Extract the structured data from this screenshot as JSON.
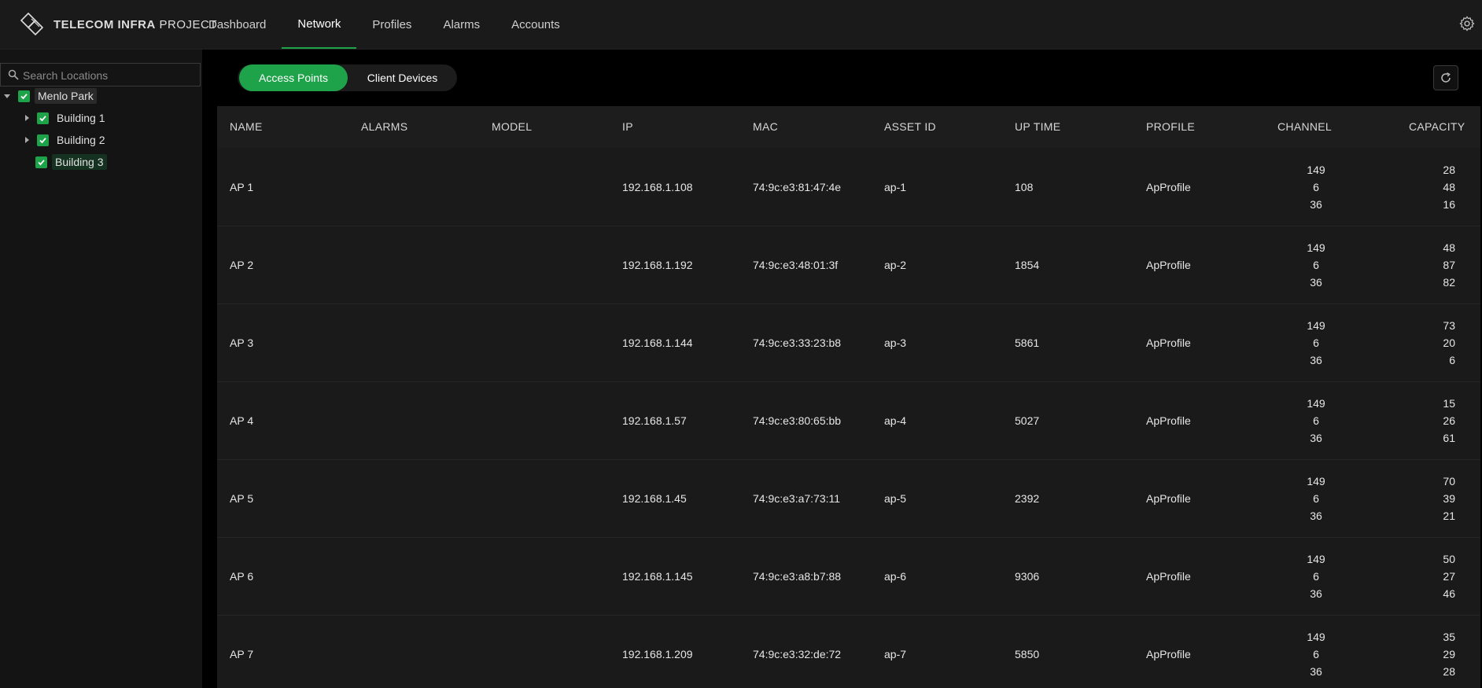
{
  "header": {
    "logo_bold": "TELECOM INFRA",
    "logo_light": "PROJECT",
    "nav": [
      {
        "label": "Dashboard",
        "active": false
      },
      {
        "label": "Network",
        "active": true
      },
      {
        "label": "Profiles",
        "active": false
      },
      {
        "label": "Alarms",
        "active": false
      },
      {
        "label": "Accounts",
        "active": false
      }
    ],
    "settings_icon": "gear-icon"
  },
  "sidebar": {
    "search_placeholder": "Search Locations",
    "tree": [
      {
        "label": "Menlo Park",
        "level": 0,
        "expanded": true,
        "checked": true
      },
      {
        "label": "Building 1",
        "level": 1,
        "expanded": false,
        "checked": true
      },
      {
        "label": "Building 2",
        "level": 1,
        "expanded": false,
        "checked": true
      },
      {
        "label": "Building 3",
        "level": 1,
        "expanded": null,
        "checked": true
      }
    ]
  },
  "main": {
    "toggle": {
      "access_points": "Access Points",
      "client_devices": "Client Devices",
      "active": "access_points"
    },
    "refresh_icon": "refresh-icon",
    "columns": [
      "NAME",
      "ALARMS",
      "MODEL",
      "IP",
      "MAC",
      "ASSET ID",
      "UP TIME",
      "PROFILE",
      "CHANNEL",
      "CAPACITY"
    ],
    "rows": [
      {
        "name": "AP 1",
        "alarms": "",
        "model": "",
        "ip": "192.168.1.108",
        "mac": "74:9c:e3:81:47:4e",
        "asset": "ap-1",
        "uptime": "108",
        "profile": "ApProfile",
        "ch": [
          "149",
          "6",
          "36"
        ],
        "cap": [
          "28",
          "48",
          "16"
        ]
      },
      {
        "name": "AP 2",
        "alarms": "",
        "model": "",
        "ip": "192.168.1.192",
        "mac": "74:9c:e3:48:01:3f",
        "asset": "ap-2",
        "uptime": "1854",
        "profile": "ApProfile",
        "ch": [
          "149",
          "6",
          "36"
        ],
        "cap": [
          "48",
          "87",
          "82"
        ]
      },
      {
        "name": "AP 3",
        "alarms": "",
        "model": "",
        "ip": "192.168.1.144",
        "mac": "74:9c:e3:33:23:b8",
        "asset": "ap-3",
        "uptime": "5861",
        "profile": "ApProfile",
        "ch": [
          "149",
          "6",
          "36"
        ],
        "cap": [
          "73",
          "20",
          "6"
        ]
      },
      {
        "name": "AP 4",
        "alarms": "",
        "model": "",
        "ip": "192.168.1.57",
        "mac": "74:9c:e3:80:65:bb",
        "asset": "ap-4",
        "uptime": "5027",
        "profile": "ApProfile",
        "ch": [
          "149",
          "6",
          "36"
        ],
        "cap": [
          "15",
          "26",
          "61"
        ]
      },
      {
        "name": "AP 5",
        "alarms": "",
        "model": "",
        "ip": "192.168.1.45",
        "mac": "74:9c:e3:a7:73:11",
        "asset": "ap-5",
        "uptime": "2392",
        "profile": "ApProfile",
        "ch": [
          "149",
          "6",
          "36"
        ],
        "cap": [
          "70",
          "39",
          "21"
        ]
      },
      {
        "name": "AP 6",
        "alarms": "",
        "model": "",
        "ip": "192.168.1.145",
        "mac": "74:9c:e3:a8:b7:88",
        "asset": "ap-6",
        "uptime": "9306",
        "profile": "ApProfile",
        "ch": [
          "149",
          "6",
          "36"
        ],
        "cap": [
          "50",
          "27",
          "46"
        ]
      },
      {
        "name": "AP 7",
        "alarms": "",
        "model": "",
        "ip": "192.168.1.209",
        "mac": "74:9c:e3:32:de:72",
        "asset": "ap-7",
        "uptime": "5850",
        "profile": "ApProfile",
        "ch": [
          "149",
          "6",
          "36"
        ],
        "cap": [
          "35",
          "29",
          "28"
        ]
      }
    ]
  },
  "colors": {
    "accent": "#1fa34a",
    "background": "#000000",
    "panel": "#1a1a1a"
  }
}
